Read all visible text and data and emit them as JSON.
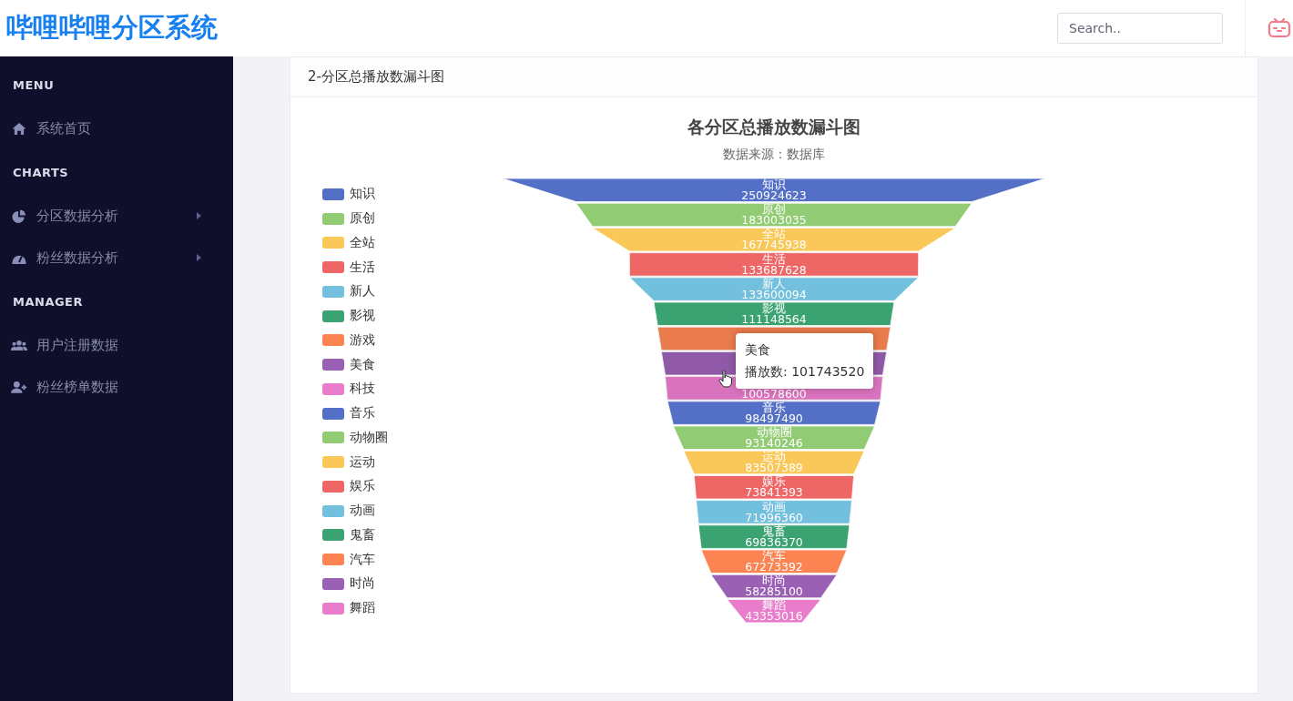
{
  "header": {
    "title": "哔哩哔哩分区系统",
    "search": {
      "placeholder": "Search.."
    }
  },
  "sidebar": {
    "sections": [
      {
        "heading": "MENU",
        "items": [
          {
            "label": "系统首页",
            "has_submenu": false
          }
        ]
      },
      {
        "heading": "CHARTS",
        "items": [
          {
            "label": "分区数据分析",
            "has_submenu": true
          },
          {
            "label": "粉丝数据分析",
            "has_submenu": true
          }
        ]
      },
      {
        "heading": "MANAGER",
        "items": [
          {
            "label": "用户注册数据",
            "has_submenu": false
          },
          {
            "label": "粉丝榜单数据",
            "has_submenu": false
          }
        ]
      }
    ]
  },
  "panel": {
    "title": "2-分区总播放数漏斗图",
    "legend": [
      {
        "label": "知识",
        "color": "#5470c6"
      },
      {
        "label": "原创",
        "color": "#91cc75"
      },
      {
        "label": "全站",
        "color": "#fac858"
      },
      {
        "label": "生活",
        "color": "#ee6666"
      },
      {
        "label": "新人",
        "color": "#73c0de"
      },
      {
        "label": "影视",
        "color": "#3ba272"
      },
      {
        "label": "游戏",
        "color": "#fc8452"
      },
      {
        "label": "美食",
        "color": "#9a60b4"
      },
      {
        "label": "科技",
        "color": "#ea7ccc"
      },
      {
        "label": "音乐",
        "color": "#5470c6"
      },
      {
        "label": "动物圈",
        "color": "#91cc75"
      },
      {
        "label": "运动",
        "color": "#fac858"
      },
      {
        "label": "娱乐",
        "color": "#ee6666"
      },
      {
        "label": "动画",
        "color": "#73c0de"
      },
      {
        "label": "鬼畜",
        "color": "#3ba272"
      },
      {
        "label": "汽车",
        "color": "#fc8452"
      },
      {
        "label": "时尚",
        "color": "#9a60b4"
      },
      {
        "label": "舞蹈",
        "color": "#ea7ccc"
      }
    ],
    "funnel": {
      "title": "各分区总播放数漏斗图",
      "subtitle": "数据来源：数据库",
      "segments": [
        {
          "label": "知识",
          "value": "250924623"
        },
        {
          "label": "原创",
          "value": "183003035"
        },
        {
          "label": "全站",
          "value": "167745938"
        },
        {
          "label": "生活",
          "value": "133687628"
        },
        {
          "label": "新人",
          "value": "133600094"
        },
        {
          "label": "影视",
          "value": "111148564"
        },
        {
          "kind": "covered"
        },
        {
          "kind": "covered"
        },
        {
          "kind": "covered",
          "value": "100578600"
        },
        {
          "label": "音乐",
          "value": "98497490"
        },
        {
          "label": "动物圈",
          "value": "93140246"
        },
        {
          "label": "运动",
          "value": "83507389"
        },
        {
          "label": "娱乐",
          "value": "73841393"
        },
        {
          "label": "动画",
          "value": "71996360"
        },
        {
          "label": "鬼畜",
          "value": "69836370"
        },
        {
          "label": "汽车",
          "value": "67273392"
        },
        {
          "label": "时尚",
          "value": "58285100"
        },
        {
          "label": "舞蹈",
          "value": "43353016"
        }
      ]
    },
    "tooltip": {
      "title": "美食",
      "text": "播放数: 101743520"
    }
  }
}
